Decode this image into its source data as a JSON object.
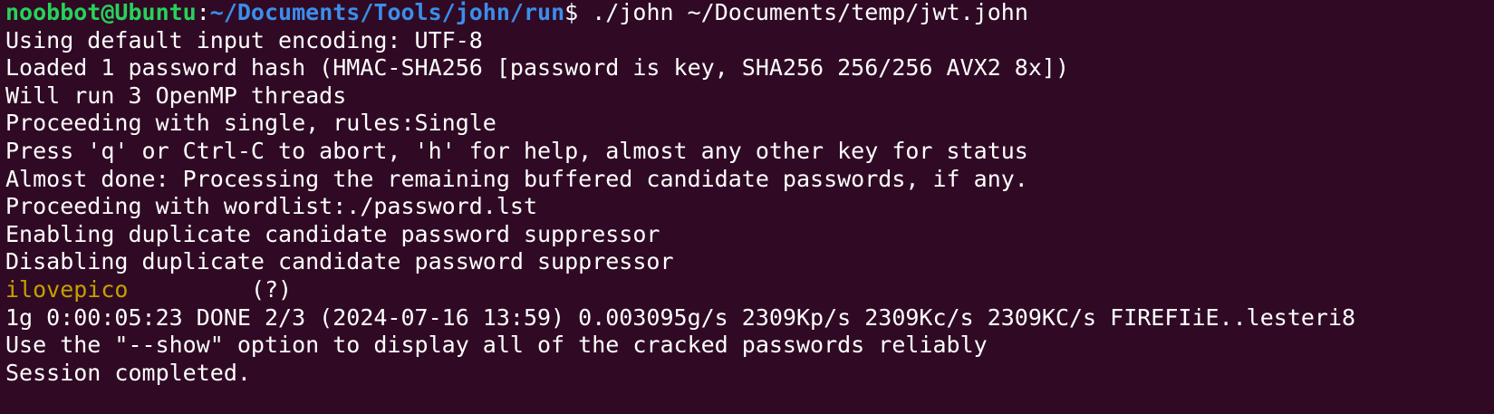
{
  "prompt": {
    "user_host": "noobbot@Ubuntu",
    "separator": ":",
    "cwd": "~/Documents/Tools/john/run",
    "symbol": "$",
    "command": " ./john ~/Documents/temp/jwt.john"
  },
  "output": {
    "line1": "Using default input encoding: UTF-8",
    "line2": "Loaded 1 password hash (HMAC-SHA256 [password is key, SHA256 256/256 AVX2 8x])",
    "line3": "Will run 3 OpenMP threads",
    "line4": "Proceeding with single, rules:Single",
    "line5": "Press 'q' or Ctrl-C to abort, 'h' for help, almost any other key for status",
    "line6": "Almost done: Processing the remaining buffered candidate passwords, if any.",
    "line7": "Proceeding with wordlist:./password.lst",
    "line8": "Enabling duplicate candidate password suppressor",
    "line9": "Disabling duplicate candidate password suppressor",
    "cracked_password": "ilovepico",
    "cracked_gap": "         ",
    "cracked_label": "(?)",
    "line11": "1g 0:00:05:23 DONE 2/3 (2024-07-16 13:59) 0.003095g/s 2309Kp/s 2309Kc/s 2309KC/s FIREFIiE..lesteri8",
    "line12": "Use the \"--show\" option to display all of the cracked passwords reliably",
    "line13": "Session completed."
  },
  "colors": {
    "background": "#300a24",
    "user_host": "#26d35a",
    "path": "#3b8eea",
    "text": "#ffffff",
    "highlight": "#c4a000"
  }
}
